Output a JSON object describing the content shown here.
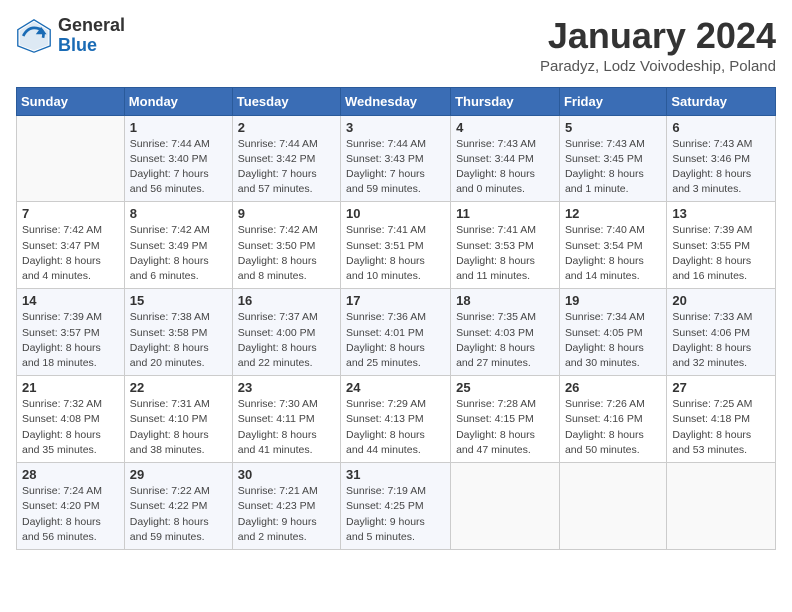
{
  "header": {
    "logo_general": "General",
    "logo_blue": "Blue",
    "calendar_title": "January 2024",
    "calendar_subtitle": "Paradyz, Lodz Voivodeship, Poland"
  },
  "days_of_week": [
    "Sunday",
    "Monday",
    "Tuesday",
    "Wednesday",
    "Thursday",
    "Friday",
    "Saturday"
  ],
  "weeks": [
    [
      {
        "day": "",
        "info": ""
      },
      {
        "day": "1",
        "info": "Sunrise: 7:44 AM\nSunset: 3:40 PM\nDaylight: 7 hours\nand 56 minutes."
      },
      {
        "day": "2",
        "info": "Sunrise: 7:44 AM\nSunset: 3:42 PM\nDaylight: 7 hours\nand 57 minutes."
      },
      {
        "day": "3",
        "info": "Sunrise: 7:44 AM\nSunset: 3:43 PM\nDaylight: 7 hours\nand 59 minutes."
      },
      {
        "day": "4",
        "info": "Sunrise: 7:43 AM\nSunset: 3:44 PM\nDaylight: 8 hours\nand 0 minutes."
      },
      {
        "day": "5",
        "info": "Sunrise: 7:43 AM\nSunset: 3:45 PM\nDaylight: 8 hours\nand 1 minute."
      },
      {
        "day": "6",
        "info": "Sunrise: 7:43 AM\nSunset: 3:46 PM\nDaylight: 8 hours\nand 3 minutes."
      }
    ],
    [
      {
        "day": "7",
        "info": "Sunrise: 7:42 AM\nSunset: 3:47 PM\nDaylight: 8 hours\nand 4 minutes."
      },
      {
        "day": "8",
        "info": "Sunrise: 7:42 AM\nSunset: 3:49 PM\nDaylight: 8 hours\nand 6 minutes."
      },
      {
        "day": "9",
        "info": "Sunrise: 7:42 AM\nSunset: 3:50 PM\nDaylight: 8 hours\nand 8 minutes."
      },
      {
        "day": "10",
        "info": "Sunrise: 7:41 AM\nSunset: 3:51 PM\nDaylight: 8 hours\nand 10 minutes."
      },
      {
        "day": "11",
        "info": "Sunrise: 7:41 AM\nSunset: 3:53 PM\nDaylight: 8 hours\nand 11 minutes."
      },
      {
        "day": "12",
        "info": "Sunrise: 7:40 AM\nSunset: 3:54 PM\nDaylight: 8 hours\nand 14 minutes."
      },
      {
        "day": "13",
        "info": "Sunrise: 7:39 AM\nSunset: 3:55 PM\nDaylight: 8 hours\nand 16 minutes."
      }
    ],
    [
      {
        "day": "14",
        "info": "Sunrise: 7:39 AM\nSunset: 3:57 PM\nDaylight: 8 hours\nand 18 minutes."
      },
      {
        "day": "15",
        "info": "Sunrise: 7:38 AM\nSunset: 3:58 PM\nDaylight: 8 hours\nand 20 minutes."
      },
      {
        "day": "16",
        "info": "Sunrise: 7:37 AM\nSunset: 4:00 PM\nDaylight: 8 hours\nand 22 minutes."
      },
      {
        "day": "17",
        "info": "Sunrise: 7:36 AM\nSunset: 4:01 PM\nDaylight: 8 hours\nand 25 minutes."
      },
      {
        "day": "18",
        "info": "Sunrise: 7:35 AM\nSunset: 4:03 PM\nDaylight: 8 hours\nand 27 minutes."
      },
      {
        "day": "19",
        "info": "Sunrise: 7:34 AM\nSunset: 4:05 PM\nDaylight: 8 hours\nand 30 minutes."
      },
      {
        "day": "20",
        "info": "Sunrise: 7:33 AM\nSunset: 4:06 PM\nDaylight: 8 hours\nand 32 minutes."
      }
    ],
    [
      {
        "day": "21",
        "info": "Sunrise: 7:32 AM\nSunset: 4:08 PM\nDaylight: 8 hours\nand 35 minutes."
      },
      {
        "day": "22",
        "info": "Sunrise: 7:31 AM\nSunset: 4:10 PM\nDaylight: 8 hours\nand 38 minutes."
      },
      {
        "day": "23",
        "info": "Sunrise: 7:30 AM\nSunset: 4:11 PM\nDaylight: 8 hours\nand 41 minutes."
      },
      {
        "day": "24",
        "info": "Sunrise: 7:29 AM\nSunset: 4:13 PM\nDaylight: 8 hours\nand 44 minutes."
      },
      {
        "day": "25",
        "info": "Sunrise: 7:28 AM\nSunset: 4:15 PM\nDaylight: 8 hours\nand 47 minutes."
      },
      {
        "day": "26",
        "info": "Sunrise: 7:26 AM\nSunset: 4:16 PM\nDaylight: 8 hours\nand 50 minutes."
      },
      {
        "day": "27",
        "info": "Sunrise: 7:25 AM\nSunset: 4:18 PM\nDaylight: 8 hours\nand 53 minutes."
      }
    ],
    [
      {
        "day": "28",
        "info": "Sunrise: 7:24 AM\nSunset: 4:20 PM\nDaylight: 8 hours\nand 56 minutes."
      },
      {
        "day": "29",
        "info": "Sunrise: 7:22 AM\nSunset: 4:22 PM\nDaylight: 8 hours\nand 59 minutes."
      },
      {
        "day": "30",
        "info": "Sunrise: 7:21 AM\nSunset: 4:23 PM\nDaylight: 9 hours\nand 2 minutes."
      },
      {
        "day": "31",
        "info": "Sunrise: 7:19 AM\nSunset: 4:25 PM\nDaylight: 9 hours\nand 5 minutes."
      },
      {
        "day": "",
        "info": ""
      },
      {
        "day": "",
        "info": ""
      },
      {
        "day": "",
        "info": ""
      }
    ]
  ]
}
